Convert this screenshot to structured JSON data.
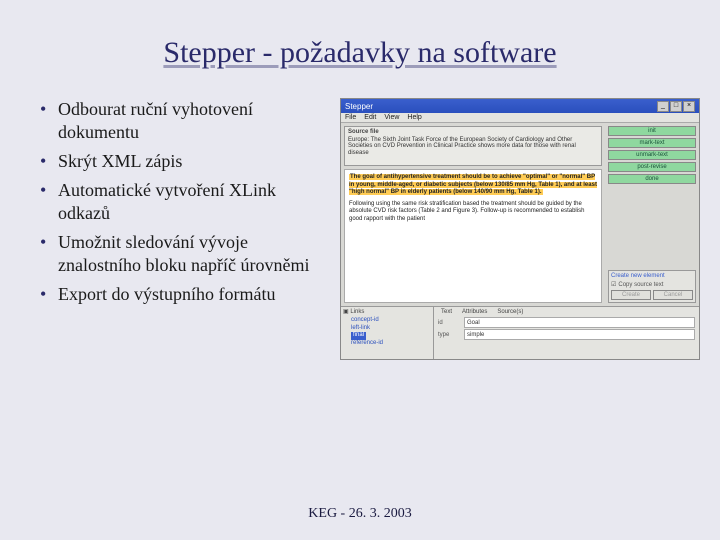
{
  "slide": {
    "title": "Stepper - požadavky na software",
    "footer": "KEG - 26. 3. 2003"
  },
  "bullets": [
    "Odbourat ruční vyhotovení dokumentu",
    "Skrýt XML zápis",
    "Automatické vytvoření XLink odkazů",
    "Umožnit sledování vývoje znalostního bloku napříč úrovněmi",
    "Export do výstupního formátu"
  ],
  "app": {
    "title": "Stepper",
    "menu": [
      "File",
      "Edit",
      "View",
      "Help"
    ],
    "source_label": "Source file",
    "source_text": "Europe: The Sixth Joint Task Force of the European Society of Cardiology and Other Societies on CVD Prevention in Clinical Practice shows more data for those with renal disease",
    "doc_highlight": "The goal of antihypertensive treatment should be to achieve \"optimal\" or \"normal\" BP in young, middle-aged, or diabetic subjects (below 130/85 mm Hg, Table 1), and at least \"high normal\" BP in elderly patients (below 140/90 mm Hg, Table 1).",
    "doc_rest": "Following using the same risk stratification based the treatment should be guided by the absolute CVD risk factors (Table 2 and Figure 3). Follow-up is recommended to establish good rapport with the patient",
    "right_buttons": [
      "init",
      "mark-text",
      "unmark-text",
      "post-revise",
      "done"
    ],
    "create": {
      "header": "Create new element",
      "checkbox": "Copy source text",
      "btn_create": "Create",
      "btn_cancel": "Cancel"
    },
    "tree_label": "Links",
    "tree_items": [
      "concept-id",
      "left-link",
      "final",
      "reference-id"
    ],
    "tabs": [
      "Text",
      "Attributes",
      "Source(s)"
    ],
    "attrs": [
      {
        "k": "id",
        "v": "Goal"
      },
      {
        "k": "type",
        "v": "simple"
      }
    ]
  }
}
